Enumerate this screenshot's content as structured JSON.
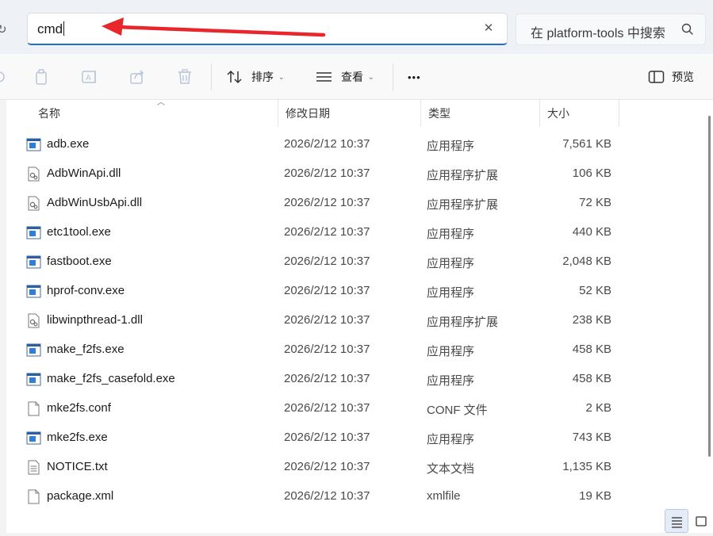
{
  "address_bar": {
    "value": "cmd",
    "clear_icon": "close-icon"
  },
  "search": {
    "placeholder": "在 platform-tools 中搜索",
    "icon": "search-icon"
  },
  "toolbar": {
    "sort_label": "排序",
    "view_label": "查看",
    "more_label": "•••",
    "preview_label": "预览"
  },
  "columns": {
    "name": "名称",
    "date": "修改日期",
    "type": "类型",
    "size": "大小"
  },
  "files": [
    {
      "name": "adb.exe",
      "date": "2026/2/12 10:37",
      "type": "应用程序",
      "size": "7,561 KB",
      "icon": "exe"
    },
    {
      "name": "AdbWinApi.dll",
      "date": "2026/2/12 10:37",
      "type": "应用程序扩展",
      "size": "106 KB",
      "icon": "dll"
    },
    {
      "name": "AdbWinUsbApi.dll",
      "date": "2026/2/12 10:37",
      "type": "应用程序扩展",
      "size": "72 KB",
      "icon": "dll"
    },
    {
      "name": "etc1tool.exe",
      "date": "2026/2/12 10:37",
      "type": "应用程序",
      "size": "440 KB",
      "icon": "exe"
    },
    {
      "name": "fastboot.exe",
      "date": "2026/2/12 10:37",
      "type": "应用程序",
      "size": "2,048 KB",
      "icon": "exe"
    },
    {
      "name": "hprof-conv.exe",
      "date": "2026/2/12 10:37",
      "type": "应用程序",
      "size": "52 KB",
      "icon": "exe"
    },
    {
      "name": "libwinpthread-1.dll",
      "date": "2026/2/12 10:37",
      "type": "应用程序扩展",
      "size": "238 KB",
      "icon": "dll"
    },
    {
      "name": "make_f2fs.exe",
      "date": "2026/2/12 10:37",
      "type": "应用程序",
      "size": "458 KB",
      "icon": "exe"
    },
    {
      "name": "make_f2fs_casefold.exe",
      "date": "2026/2/12 10:37",
      "type": "应用程序",
      "size": "458 KB",
      "icon": "exe"
    },
    {
      "name": "mke2fs.conf",
      "date": "2026/2/12 10:37",
      "type": "CONF 文件",
      "size": "2 KB",
      "icon": "file"
    },
    {
      "name": "mke2fs.exe",
      "date": "2026/2/12 10:37",
      "type": "应用程序",
      "size": "743 KB",
      "icon": "exe"
    },
    {
      "name": "NOTICE.txt",
      "date": "2026/2/12 10:37",
      "type": "文本文档",
      "size": "1,135 KB",
      "icon": "txt"
    },
    {
      "name": "package.xml",
      "date": "2026/2/12 10:37",
      "type": "xmlfile",
      "size": "19 KB",
      "icon": "file"
    }
  ],
  "colors": {
    "accent": "#1f6fd1",
    "annotation": "#e8262b"
  }
}
